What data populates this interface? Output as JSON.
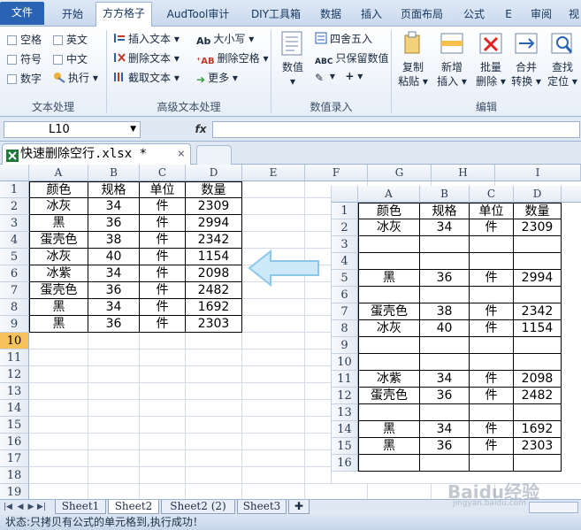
{
  "menu": {
    "tabs": [
      "文件",
      "开始",
      "方方格子",
      "AudTool审计",
      "DIY工具箱",
      "数据",
      "插入",
      "页面布局",
      "公式",
      "E",
      "审阅",
      "视"
    ],
    "active_index": 2
  },
  "ribbon": {
    "text_group": {
      "label": "文本处理",
      "checkboxes": [
        "空格",
        "英文",
        "符号",
        "中文",
        "数字"
      ],
      "exec": "执行"
    },
    "adv_group": {
      "label": "高级文本处理",
      "buttons": [
        "插入文本",
        "删除文本",
        "截取文本",
        "大小写",
        "删除空格",
        "更多"
      ]
    },
    "entry_group": {
      "label": "数值录入",
      "big": "数值",
      "buttons": [
        "四舍五入",
        "只保留数值"
      ]
    },
    "edit_group": {
      "label": "编辑",
      "big": [
        [
          "复制",
          "粘贴"
        ],
        [
          "新增",
          "插入"
        ],
        [
          "批量",
          "删除"
        ],
        [
          "合并",
          "转换"
        ],
        [
          "查找",
          "定位"
        ]
      ]
    }
  },
  "formula": {
    "name_box": "L10",
    "fx": "fx",
    "value": ""
  },
  "doc": {
    "tab_title": "快速删除空行.xlsx *",
    "close": "×"
  },
  "sheet": {
    "col_headers": [
      "A",
      "B",
      "C",
      "D",
      "E",
      "F",
      "G",
      "H",
      "I"
    ],
    "row_headers": [
      "1",
      "2",
      "3",
      "4",
      "5",
      "6",
      "7",
      "8",
      "9",
      "10",
      "11",
      "12",
      "13",
      "14",
      "15",
      "16",
      "17",
      "18",
      "19"
    ],
    "selected_row": "10",
    "rows": [
      [
        "颜色",
        "规格",
        "单位",
        "数量"
      ],
      [
        "冰灰",
        "34",
        "件",
        "2309"
      ],
      [
        "黑",
        "36",
        "件",
        "2994"
      ],
      [
        "蛋壳色",
        "38",
        "件",
        "2342"
      ],
      [
        "冰灰",
        "40",
        "件",
        "1154"
      ],
      [
        "冰紫",
        "34",
        "件",
        "2098"
      ],
      [
        "蛋壳色",
        "36",
        "件",
        "2482"
      ],
      [
        "黑",
        "34",
        "件",
        "1692"
      ],
      [
        "黑",
        "36",
        "件",
        "2303"
      ]
    ]
  },
  "before_image": {
    "col_headers": [
      "A",
      "B",
      "C",
      "D"
    ],
    "row_headers": [
      "1",
      "2",
      "3",
      "4",
      "5",
      "6",
      "7",
      "8",
      "9",
      "10",
      "11",
      "12",
      "13",
      "14",
      "15",
      "16"
    ],
    "rows": [
      [
        "颜色",
        "规格",
        "单位",
        "数量"
      ],
      [
        "冰灰",
        "34",
        "件",
        "2309"
      ],
      [
        "",
        "",
        "",
        ""
      ],
      [
        "",
        "",
        "",
        ""
      ],
      [
        "黑",
        "36",
        "件",
        "2994"
      ],
      [
        "",
        "",
        "",
        ""
      ],
      [
        "蛋壳色",
        "38",
        "件",
        "2342"
      ],
      [
        "冰灰",
        "40",
        "件",
        "1154"
      ],
      [
        "",
        "",
        "",
        ""
      ],
      [
        "",
        "",
        "",
        ""
      ],
      [
        "冰紫",
        "34",
        "件",
        "2098"
      ],
      [
        "蛋壳色",
        "36",
        "件",
        "2482"
      ],
      [
        "",
        "",
        "",
        ""
      ],
      [
        "黑",
        "34",
        "件",
        "1692"
      ],
      [
        "黑",
        "36",
        "件",
        "2303"
      ],
      [
        "",
        "",
        "",
        ""
      ]
    ]
  },
  "sheet_tabs": {
    "items": [
      "Sheet1",
      "Sheet2",
      "Sheet2 (2)",
      "Sheet3"
    ],
    "active": "Sheet2"
  },
  "status": {
    "text": "状态:只拷贝有公式的单元格到,执行成功！"
  },
  "watermark": {
    "brand": "Baidu经验",
    "url": "jingyan.baidu.com"
  },
  "colors": {
    "accent": "#2a62b4",
    "selected_row": "#f7c25b",
    "arrow": "#bfe0f5"
  }
}
